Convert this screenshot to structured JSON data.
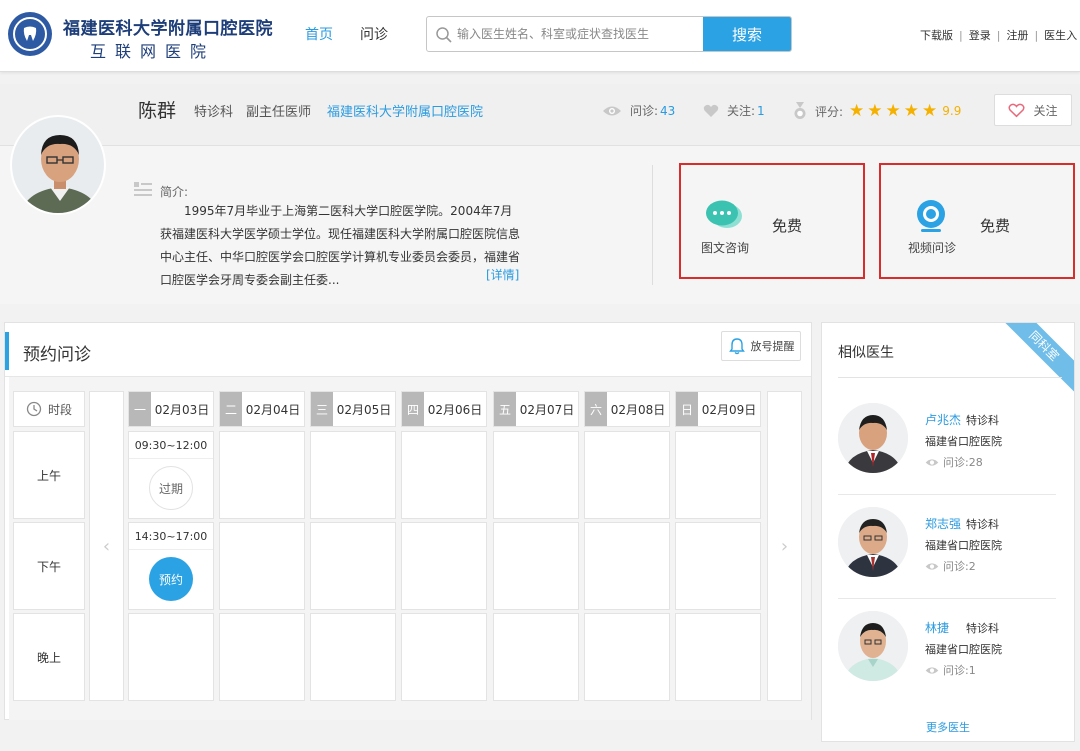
{
  "header": {
    "brand_main": "福建医科大学附属口腔医院",
    "brand_sub": "互联网医院",
    "nav": [
      {
        "label": "首页",
        "active": true
      },
      {
        "label": "问诊",
        "active": false
      }
    ],
    "search": {
      "placeholder": "输入医生姓名、科室或症状查找医生",
      "button": "搜索"
    },
    "links": [
      "下载版",
      "登录",
      "注册",
      "医生入"
    ]
  },
  "doctor": {
    "name": "陈群",
    "dept": "特诊科",
    "title": "副主任医师",
    "hospital": "福建医科大学附属口腔医院",
    "consult_label": "问诊:",
    "consult_count": "43",
    "follow_label": "关注:",
    "follow_count": "1",
    "rating_label": "评分:",
    "rating_score": "9.9",
    "rating_stars": 5,
    "follow_button": "关注",
    "intro_label": "简介:",
    "intro_text": "1995年7月毕业于上海第二医科大学口腔医学院。2004年7月获福建医科大学医学硕士学位。现任福建医科大学附属口腔医院信息中心主任、中华口腔医学会口腔医学计算机专业委员会委员，福建省口腔医学会牙周专委会副主任委...",
    "detail_link": "[详情]"
  },
  "services": [
    {
      "label": "图文咨询",
      "price": "免费",
      "icon": "chat-bubble-icon"
    },
    {
      "label": "视频问诊",
      "price": "免费",
      "icon": "webcam-icon"
    }
  ],
  "appointment": {
    "title": "预约问诊",
    "remind_button": "放号提醒",
    "time_header": "时段",
    "periods": [
      "上午",
      "下午",
      "晚上"
    ],
    "days": [
      {
        "weekday": "一",
        "date": "02月03日"
      },
      {
        "weekday": "二",
        "date": "02月04日"
      },
      {
        "weekday": "三",
        "date": "02月05日"
      },
      {
        "weekday": "四",
        "date": "02月06日"
      },
      {
        "weekday": "五",
        "date": "02月07日"
      },
      {
        "weekday": "六",
        "date": "02月08日"
      },
      {
        "weekday": "日",
        "date": "02月09日"
      }
    ],
    "slots": [
      {
        "time": "09:30~12:00",
        "status": "过期"
      },
      {
        "time": "14:30~17:00",
        "status": "预约"
      }
    ]
  },
  "similar": {
    "title": "相似医生",
    "ribbon": "同科室",
    "views_label": "问诊:",
    "doctors": [
      {
        "name": "卢兆杰",
        "dept": "特诊科",
        "hospital": "福建省口腔医院",
        "views": "28"
      },
      {
        "name": "郑志强",
        "dept": "特诊科",
        "hospital": "福建省口腔医院",
        "views": "2"
      },
      {
        "name": "林捷",
        "dept": "特诊科",
        "hospital": "福建省口腔医院",
        "views": "1"
      }
    ],
    "more": "更多医生"
  },
  "colors": {
    "accent": "#2ba2e3",
    "highlight_box": "#d92c2c",
    "star": "#f5b100",
    "brand": "#1e3e7a"
  }
}
